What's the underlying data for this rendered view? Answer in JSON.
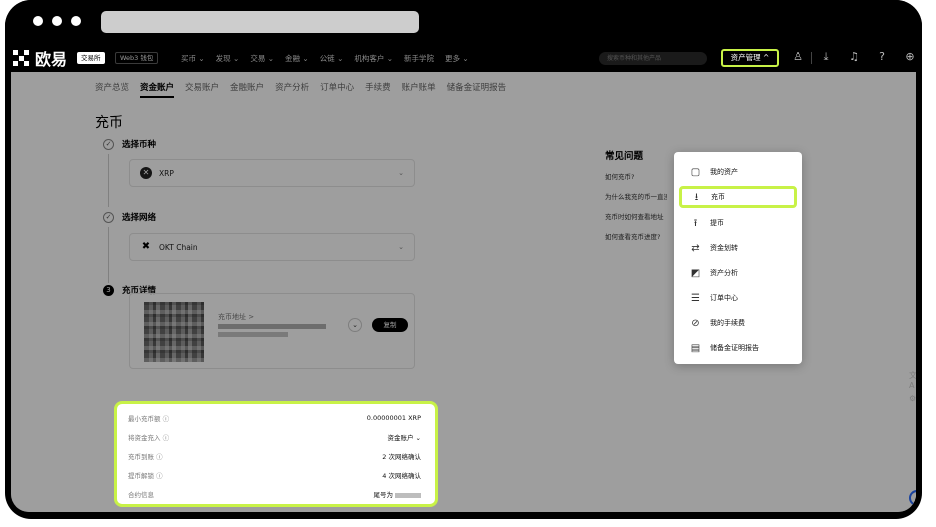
{
  "browser": {
    "address": ""
  },
  "brand": {
    "name": "欧易"
  },
  "nav": {
    "exchange": "交易所",
    "web3": "Web3 钱包",
    "items": [
      "买币 ⌄",
      "发现 ⌄",
      "交易 ⌄",
      "金融 ⌄",
      "公链 ⌄",
      "机构客户 ⌄",
      "新手学院",
      "更多 ⌄"
    ],
    "search_placeholder": "搜索币种和其他产品",
    "asset_management": "资产管理 ^"
  },
  "tabs": [
    "资产总览",
    "资金账户",
    "交易账户",
    "金融账户",
    "资产分析",
    "订单中心",
    "手续费",
    "账户账单",
    "储备金证明报告"
  ],
  "page_title": "充币",
  "steps": {
    "s1": {
      "label": "选择币种",
      "mark": "✓",
      "value": "XRP"
    },
    "s2": {
      "label": "选择网络",
      "mark": "✓",
      "value": "OKT Chain"
    },
    "s3": {
      "label": "充币详情",
      "mark": "3"
    }
  },
  "deposit": {
    "address_label": "充币地址 >",
    "copy": "复制"
  },
  "info": [
    {
      "key": "最小充币额 ⓘ",
      "value": "0.00000001 XRP"
    },
    {
      "key": "将资金充入 ⓘ",
      "value": "资金账户 ⌄"
    },
    {
      "key": "充币到账 ⓘ",
      "value": "2 次网络确认"
    },
    {
      "key": "提币解锁 ⓘ",
      "value": "4 次网络确认"
    },
    {
      "key": "合约信息",
      "value": "尾号为"
    }
  ],
  "faq": {
    "title": "常见问题",
    "items": [
      "如何充币?",
      "为什么我充的币一直没到账",
      "充币时如何查看地址",
      "如何查看充币进度?"
    ]
  },
  "dropdown": [
    {
      "label": "我的资产",
      "icon": "wallet-icon",
      "glyph": "▢"
    },
    {
      "label": "充币",
      "icon": "deposit-icon",
      "glyph": "⭳"
    },
    {
      "label": "提币",
      "icon": "withdraw-icon",
      "glyph": "⭱"
    },
    {
      "label": "资金划转",
      "icon": "transfer-icon",
      "glyph": "⇄"
    },
    {
      "label": "资产分析",
      "icon": "analysis-icon",
      "glyph": "◩"
    },
    {
      "label": "订单中心",
      "icon": "orders-icon",
      "glyph": "☰"
    },
    {
      "label": "我的手续费",
      "icon": "fee-icon",
      "glyph": "⊘"
    },
    {
      "label": "储备金证明报告",
      "icon": "report-icon",
      "glyph": "▤"
    }
  ],
  "colors": {
    "highlight": "#c8f247",
    "accent_blue": "#2b6cff"
  }
}
